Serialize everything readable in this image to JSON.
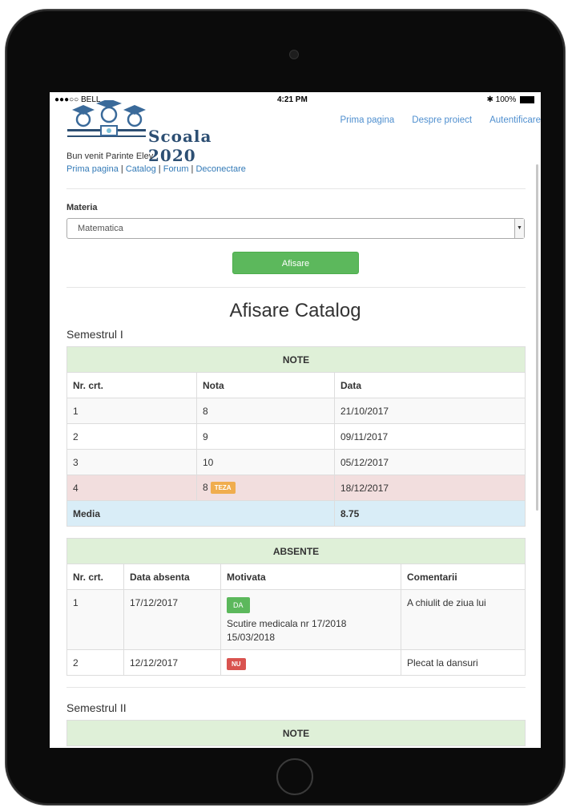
{
  "status": {
    "carrier": "●●●○○ BELL",
    "time": "4:21 PM",
    "bluetooth": "✱",
    "battery": "100%"
  },
  "brand": {
    "name": "Scoala 2020"
  },
  "nav": {
    "items": [
      {
        "label": "Prima pagina"
      },
      {
        "label": "Despre proiect"
      },
      {
        "label": "Autentificare"
      }
    ]
  },
  "user": {
    "welcome": "Bun venit Parinte Elev"
  },
  "sublinks": {
    "items": [
      "Prima pagina",
      "Catalog",
      "Forum",
      "Deconectare"
    ],
    "separator": " | "
  },
  "form": {
    "materia_label": "Materia",
    "materia_value": "Matematica",
    "submit_label": "Afisare"
  },
  "page": {
    "title": "Afisare Catalog"
  },
  "semester1": {
    "label": "Semestrul I",
    "note": {
      "caption": "NOTE",
      "columns": [
        "Nr. crt.",
        "Nota",
        "Data"
      ],
      "rows": [
        {
          "nr": "1",
          "nota": "8",
          "data": "21/10/2017"
        },
        {
          "nr": "2",
          "nota": "9",
          "data": "09/11/2017"
        },
        {
          "nr": "3",
          "nota": "10",
          "data": "05/12/2017"
        },
        {
          "nr": "4",
          "nota": "8",
          "badge": "TEZA",
          "data": "18/12/2017"
        }
      ],
      "media_label": "Media",
      "media_value": "8.75"
    },
    "absente": {
      "caption": "ABSENTE",
      "columns": [
        "Nr. crt.",
        "Data absenta",
        "Motivata",
        "Comentarii"
      ],
      "rows": [
        {
          "nr": "1",
          "data": "17/12/2017",
          "motivata": "DA",
          "note_line1": "Scutire medicala nr 17/2018",
          "note_line2": "15/03/2018",
          "comentariu": "A chiulit de ziua lui"
        },
        {
          "nr": "2",
          "data": "12/12/2017",
          "motivata": "NU",
          "comentariu": "Plecat la dansuri"
        }
      ]
    }
  },
  "semester2": {
    "label": "Semestrul II",
    "note_caption": "NOTE"
  },
  "colors": {
    "success": "#5cb85c",
    "warning": "#f0ad4e",
    "danger": "#d9534f",
    "link": "#337ab7",
    "caption_bg": "#dff0d8",
    "media_bg": "#d9edf7",
    "teza_row_bg": "#f2dede"
  }
}
